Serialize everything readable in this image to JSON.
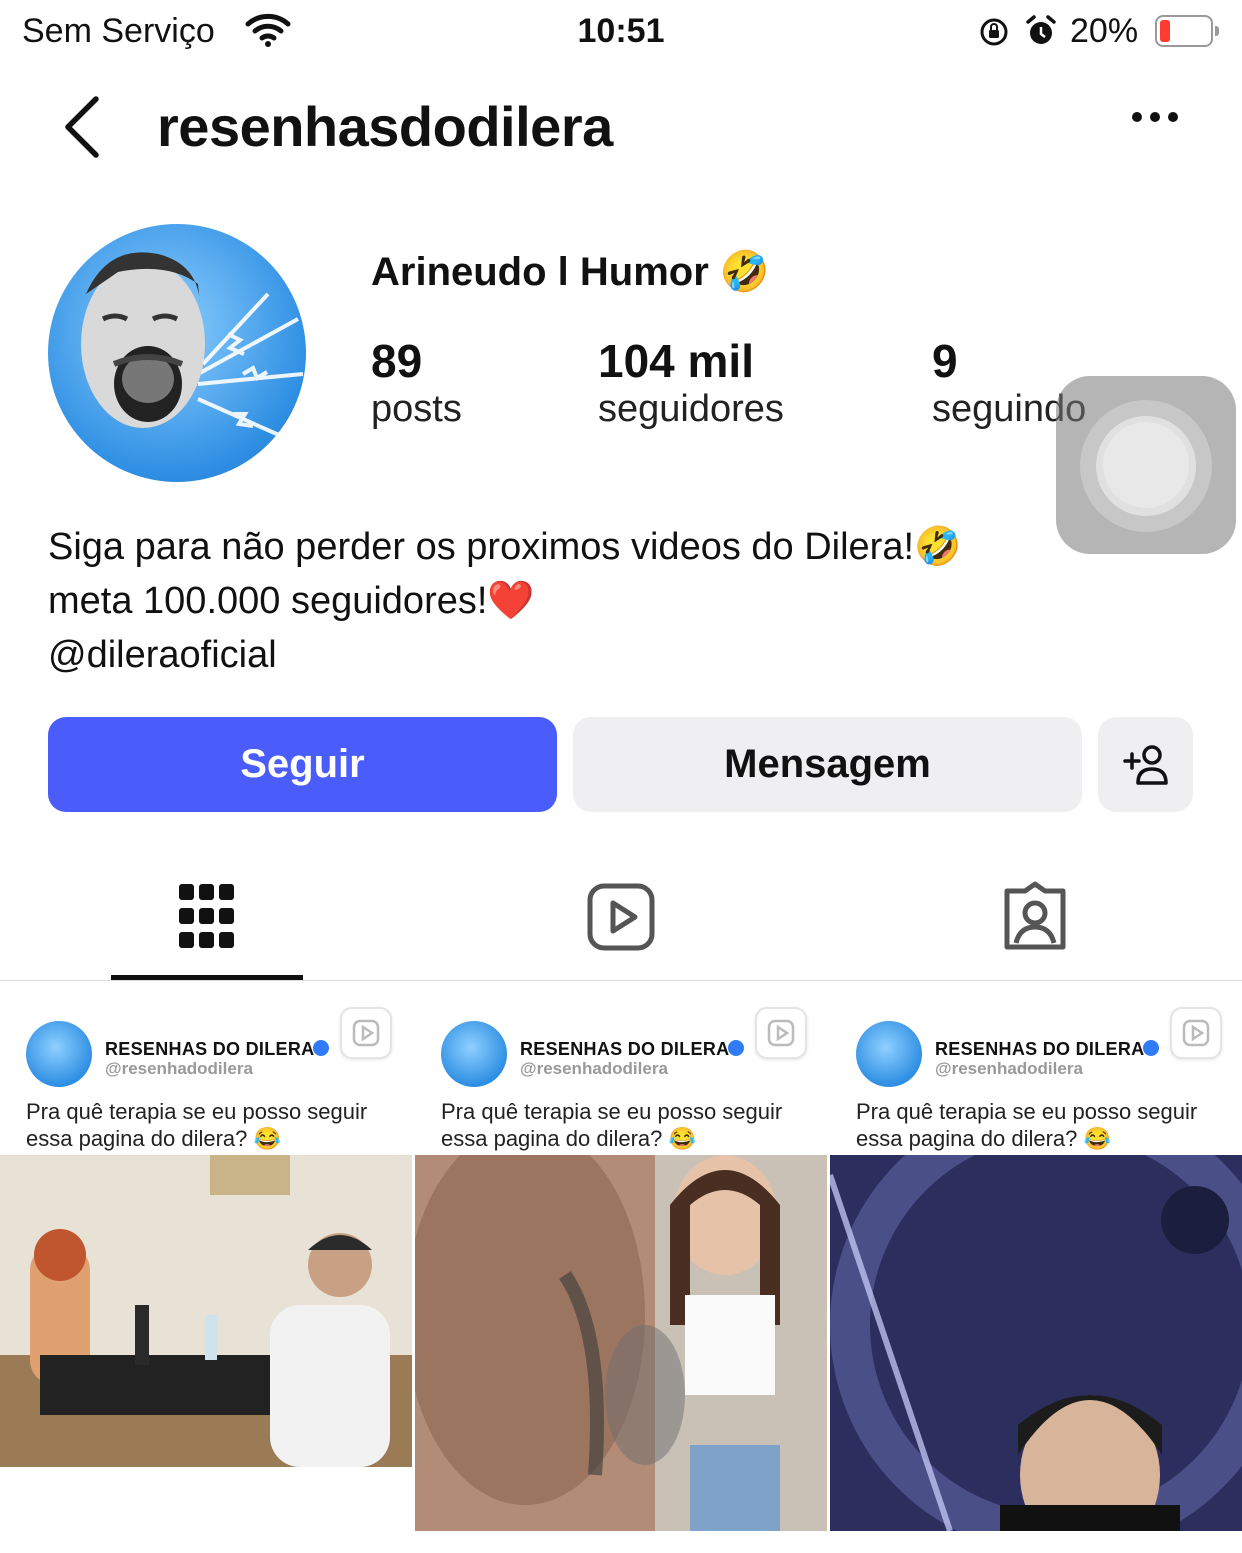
{
  "status_bar": {
    "carrier": "Sem Serviço",
    "time": "10:51",
    "battery_percent": "20%",
    "battery_level": 0.2,
    "icons": [
      "wifi-icon",
      "rotation-lock-icon",
      "alarm-icon",
      "battery-icon"
    ]
  },
  "header": {
    "username": "resenhasdodilera",
    "back_icon": "chevron-left-icon",
    "more_icon": "more-horizontal-icon"
  },
  "profile": {
    "display_name": "Arineudo l Humor 🤣",
    "stats": [
      {
        "value": "89",
        "label": "posts"
      },
      {
        "value": "104 mil",
        "label": "seguidores"
      },
      {
        "value": "9",
        "label": "seguindo"
      }
    ],
    "bio": [
      "Siga para não perder os proximos videos do Dilera!🤣",
      "meta 100.000 seguidores!❤️",
      "@dileraoficial"
    ]
  },
  "actions": {
    "follow_label": "Seguir",
    "message_label": "Mensagem",
    "add_user_icon": "add-person-icon"
  },
  "colors": {
    "follow_button": "#4a5cfa",
    "secondary_button": "#efeff1",
    "avatar_blue": "#2f8fe3"
  },
  "tabs": [
    {
      "name": "grid",
      "icon": "grid-icon",
      "active": true
    },
    {
      "name": "reels",
      "icon": "reels-icon",
      "active": false
    },
    {
      "name": "tagged",
      "icon": "tagged-icon",
      "active": false
    }
  ],
  "posts": [
    {
      "account_name": "RESENHAS DO DILERA",
      "handle": "@resenhadodilera",
      "caption": "Pra quê terapia se eu posso seguir essa pagina do dilera? 😂"
    },
    {
      "account_name": "RESENHAS DO DILERA",
      "handle": "@resenhadodilera",
      "caption": "Pra quê terapia se eu posso seguir essa pagina do dilera? 😂"
    },
    {
      "account_name": "RESENHAS DO DILERA",
      "handle": "@resenhadodilera",
      "caption": "Pra quê terapia se eu posso seguir essa pagina do dilera? 😂"
    }
  ]
}
